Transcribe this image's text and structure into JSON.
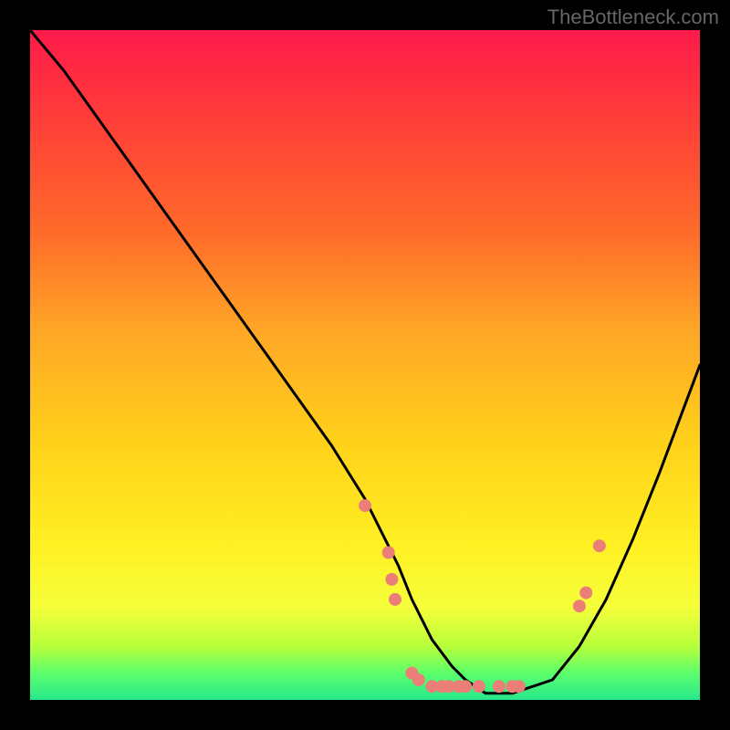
{
  "watermark": "TheBottleneck.com",
  "colors": {
    "background": "#000000",
    "curve_stroke": "#000000",
    "marker_fill": "#eb7e76",
    "gradient_stops": [
      "#ff1a4b",
      "#ff3a3a",
      "#ff6a2a",
      "#ffa726",
      "#ffd21a",
      "#fff023",
      "#f6ff3a",
      "#b7ff3a",
      "#5cff6b",
      "#27e88c"
    ]
  },
  "chart_data": {
    "type": "line",
    "title": "",
    "xlabel": "",
    "ylabel": "",
    "xlim": [
      0,
      100
    ],
    "ylim": [
      0,
      100
    ],
    "series": [
      {
        "name": "curve",
        "x": [
          0,
          5,
          10,
          15,
          20,
          25,
          30,
          35,
          40,
          45,
          50,
          55,
          57,
          60,
          63,
          65,
          68,
          72,
          78,
          82,
          86,
          90,
          94,
          100
        ],
        "y": [
          100,
          94,
          87,
          80,
          73,
          66,
          59,
          52,
          45,
          38,
          30,
          20,
          15,
          9,
          5,
          3,
          1,
          1,
          3,
          8,
          15,
          24,
          34,
          50
        ]
      }
    ],
    "markers": [
      {
        "x": 50.0,
        "y": 29
      },
      {
        "x": 53.5,
        "y": 22
      },
      {
        "x": 54.0,
        "y": 18
      },
      {
        "x": 54.5,
        "y": 15
      },
      {
        "x": 57.0,
        "y": 4
      },
      {
        "x": 58.0,
        "y": 3
      },
      {
        "x": 60.0,
        "y": 2
      },
      {
        "x": 61.5,
        "y": 2
      },
      {
        "x": 62.5,
        "y": 2
      },
      {
        "x": 64.0,
        "y": 2
      },
      {
        "x": 65.0,
        "y": 2
      },
      {
        "x": 67.0,
        "y": 2
      },
      {
        "x": 70.0,
        "y": 2
      },
      {
        "x": 72.0,
        "y": 2
      },
      {
        "x": 73.0,
        "y": 2
      },
      {
        "x": 82.0,
        "y": 14
      },
      {
        "x": 83.0,
        "y": 16
      },
      {
        "x": 85.0,
        "y": 23
      }
    ]
  }
}
